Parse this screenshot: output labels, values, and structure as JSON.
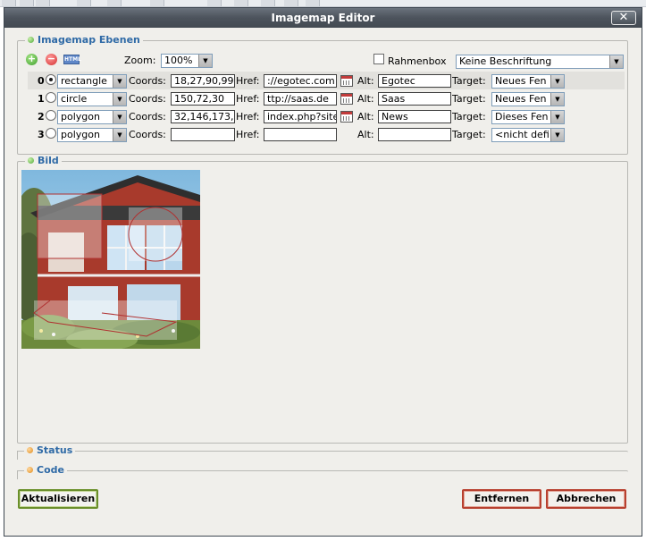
{
  "dialog": {
    "title": "Imagemap Editor",
    "close_label": "✕"
  },
  "layers": {
    "legend": "Imagemap Ebenen",
    "zoom_label": "Zoom:",
    "zoom_value": "100%",
    "frame_label": "Rahmenbox",
    "caption_value": "Keine Beschriftung",
    "coords_label": "Coords:",
    "href_label": "Href:",
    "alt_label": "Alt:",
    "target_label": "Target:",
    "rows": [
      {
        "index": "0",
        "shape": "rectangle",
        "coords": "18,27,90,99",
        "href": "://egotec.com",
        "alt": "Egotec",
        "target": "Neues Fen"
      },
      {
        "index": "1",
        "shape": "circle",
        "coords": "150,72,30",
        "href": "ttp://saas.de",
        "alt": "Saas",
        "target": "Neues Fen"
      },
      {
        "index": "2",
        "shape": "polygon",
        "coords": "32,146,173,",
        "href": "index.php?site",
        "alt": "News",
        "target": "Dieses Fen"
      },
      {
        "index": "3",
        "shape": "polygon",
        "coords": "",
        "href": "",
        "alt": "",
        "target": "<nicht defi"
      }
    ]
  },
  "image_section": {
    "legend": "Bild"
  },
  "status_section": {
    "legend": "Status"
  },
  "code_section": {
    "legend": "Code"
  },
  "buttons": {
    "update": "Aktualisieren",
    "remove": "Entfernen",
    "cancel": "Abbrechen"
  }
}
